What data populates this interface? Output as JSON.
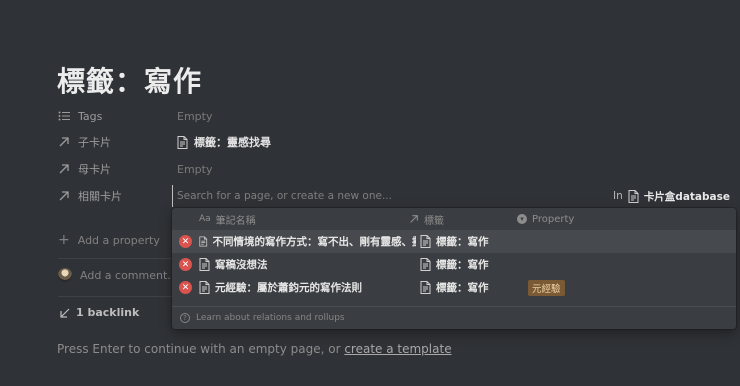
{
  "page": {
    "title": "標籤：寫作"
  },
  "properties": [
    {
      "name": "Tags",
      "value": "Empty",
      "filled": false,
      "icon": "list-icon"
    },
    {
      "name": "子卡片",
      "value": "標籤：靈感找尋",
      "filled": true,
      "icon": "relation-arrow-icon"
    },
    {
      "name": "母卡片",
      "value": "Empty",
      "filled": false,
      "icon": "relation-arrow-icon"
    },
    {
      "name": "相關卡片",
      "value": "",
      "filled": false,
      "icon": "relation-arrow-icon"
    }
  ],
  "add_property_label": "Add a property",
  "comment_placeholder": "Add a comment...",
  "backlink_label": "1 backlink",
  "footer": {
    "prefix": "Press Enter to continue with an empty page, or ",
    "link": "create a template"
  },
  "search": {
    "placeholder": "Search for a page, or create a new one...",
    "in_label": "In",
    "database_name": "卡片盒database"
  },
  "dropdown": {
    "columns": {
      "name": "筆記名稱",
      "tag": "標籤",
      "property": "Property"
    },
    "rows": [
      {
        "name": "不同情境的寫作方式：寫不出、剛有靈感、擬大綱、修稿",
        "tag": "標籤：寫作",
        "property": ""
      },
      {
        "name": "寫稿沒想法",
        "tag": "標籤：寫作",
        "property": ""
      },
      {
        "name": "元經驗：屬於蕭鈞元的寫作法則",
        "tag": "標籤：寫作",
        "property": "元經驗"
      }
    ],
    "footer_hint": "Learn about relations and rollups"
  },
  "colors": {
    "background": "#2f3236",
    "dropdown": "#3a3d41",
    "remove": "#d9534f",
    "chip_bg": "#7a5a34",
    "chip_text": "#f0d3a8"
  }
}
